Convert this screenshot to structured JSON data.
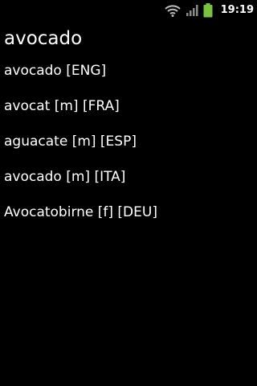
{
  "status_bar": {
    "time": "19:19",
    "icons": [
      "wifi-icon",
      "signal-icon",
      "battery-icon"
    ],
    "battery_color": "#7bc242"
  },
  "title": "avocado",
  "translations": [
    "avocado [ENG]",
    "avocat [m] [FRA]",
    "aguacate [m] [ESP]",
    "avocado [m] [ITA]",
    "Avocatobirne [f] [DEU]"
  ]
}
